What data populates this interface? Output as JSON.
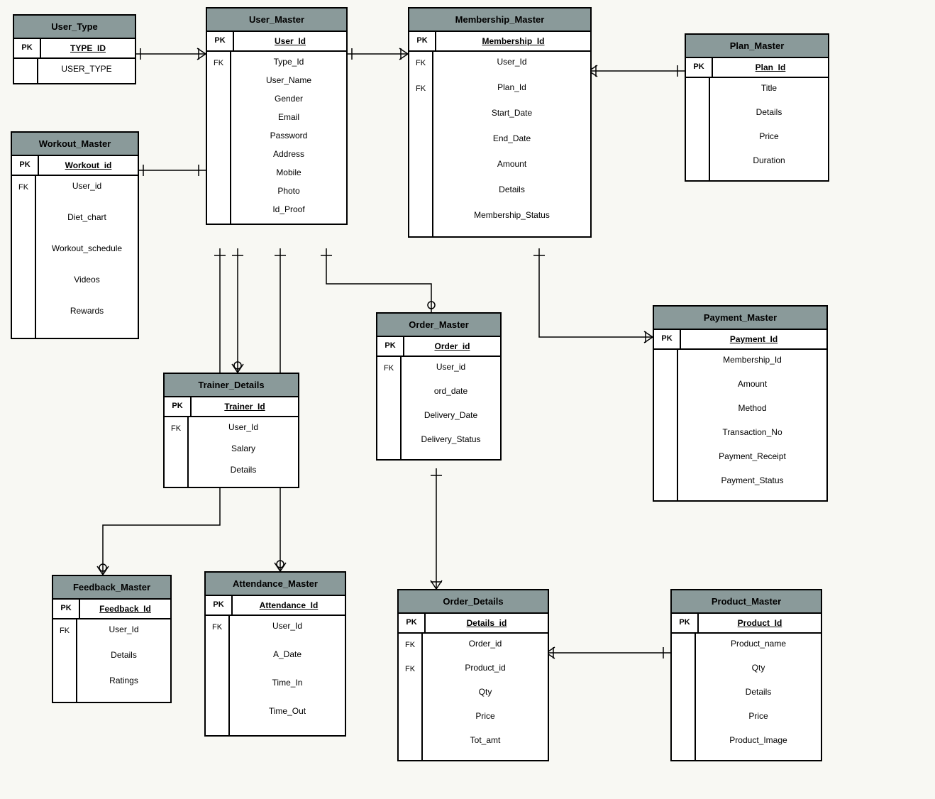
{
  "entities": {
    "user_type": {
      "title": "User_Type",
      "pk_label": "PK",
      "pk_field": "TYPE_ID",
      "keys": [
        ""
      ],
      "fields": [
        "USER_TYPE"
      ]
    },
    "user_master": {
      "title": "User_Master",
      "pk_label": "PK",
      "pk_field": "User_Id",
      "keys": [
        "FK",
        "",
        "",
        "",
        "",
        "",
        "",
        ""
      ],
      "fields": [
        "Type_Id",
        "User_Name",
        "Gender",
        "Email",
        "Password",
        "Address",
        "Mobile",
        "Photo",
        "Id_Proof"
      ]
    },
    "membership_master": {
      "title": "Membership_Master",
      "pk_label": "PK",
      "pk_field": "Membership_Id",
      "keys": [
        "FK",
        "FK",
        "",
        "",
        "",
        "",
        ""
      ],
      "fields": [
        "User_Id",
        "Plan_Id",
        "Start_Date",
        "End_Date",
        "Amount",
        "Details",
        "Membership_Status"
      ]
    },
    "plan_master": {
      "title": "Plan_Master",
      "pk_label": "PK",
      "pk_field": "Plan_Id",
      "keys": [
        "",
        "",
        "",
        ""
      ],
      "fields": [
        "Title",
        "Details",
        "Price",
        "Duration"
      ]
    },
    "workout_master": {
      "title": "Workout_Master",
      "pk_label": "PK",
      "pk_field": "Workout_id",
      "keys": [
        "FK",
        "",
        "",
        "",
        ""
      ],
      "fields": [
        "User_id",
        "Diet_chart",
        "Workout_schedule",
        "Videos",
        "Rewards"
      ]
    },
    "order_master": {
      "title": "Order_Master",
      "pk_label": "PK",
      "pk_field": "Order_id",
      "keys": [
        "FK",
        "",
        "",
        ""
      ],
      "fields": [
        "User_id",
        "ord_date",
        "Delivery_Date",
        "Delivery_Status"
      ]
    },
    "payment_master": {
      "title": "Payment_Master",
      "pk_label": "PK",
      "pk_field": "Payment_Id",
      "keys": [
        "",
        "",
        "",
        "",
        "",
        ""
      ],
      "fields": [
        "Membership_Id",
        "Amount",
        "Method",
        "Transaction_No",
        "Payment_Receipt",
        "Payment_Status"
      ]
    },
    "trainer_details": {
      "title": "Trainer_Details",
      "pk_label": "PK",
      "pk_field": "Trainer_Id",
      "keys": [
        "FK",
        "",
        ""
      ],
      "fields": [
        "User_Id",
        "Salary",
        "Details"
      ]
    },
    "feedback_master": {
      "title": "Feedback_Master",
      "pk_label": "PK",
      "pk_field": "Feedback_Id",
      "keys": [
        "FK",
        "",
        ""
      ],
      "fields": [
        "User_Id",
        "Details",
        "Ratings"
      ]
    },
    "attendance_master": {
      "title": "Attendance_Master",
      "pk_label": "PK",
      "pk_field": "Attendance_Id",
      "keys": [
        "FK",
        "",
        "",
        ""
      ],
      "fields": [
        "User_Id",
        "A_Date",
        "Time_In",
        "Time_Out"
      ]
    },
    "order_details": {
      "title": "Order_Details",
      "pk_label": "PK",
      "pk_field": "Details_id",
      "keys": [
        "FK",
        "FK",
        "",
        "",
        ""
      ],
      "fields": [
        "Order_id",
        "Product_id",
        "Qty",
        "Price",
        "Tot_amt"
      ]
    },
    "product_master": {
      "title": "Product_Master",
      "pk_label": "PK",
      "pk_field": "Product_Id",
      "keys": [
        "",
        "",
        "",
        "",
        ""
      ],
      "fields": [
        "Product_name",
        "Qty",
        "Details",
        "Price",
        "Product_Image"
      ]
    }
  },
  "relationships": [
    {
      "from": "user_type",
      "to": "user_master",
      "type": "one-to-many"
    },
    {
      "from": "user_master",
      "to": "membership_master",
      "type": "one-to-many"
    },
    {
      "from": "plan_master",
      "to": "membership_master",
      "type": "one-to-many"
    },
    {
      "from": "user_master",
      "to": "workout_master",
      "type": "one-to-one"
    },
    {
      "from": "user_master",
      "to": "order_master",
      "type": "one-to-many"
    },
    {
      "from": "membership_master",
      "to": "payment_master",
      "type": "one-to-many"
    },
    {
      "from": "user_master",
      "to": "trainer_details",
      "type": "one-to-many"
    },
    {
      "from": "user_master",
      "to": "feedback_master",
      "type": "one-to-many"
    },
    {
      "from": "user_master",
      "to": "attendance_master",
      "type": "one-to-many"
    },
    {
      "from": "order_master",
      "to": "order_details",
      "type": "one-to-many"
    },
    {
      "from": "product_master",
      "to": "order_details",
      "type": "one-to-many"
    }
  ]
}
